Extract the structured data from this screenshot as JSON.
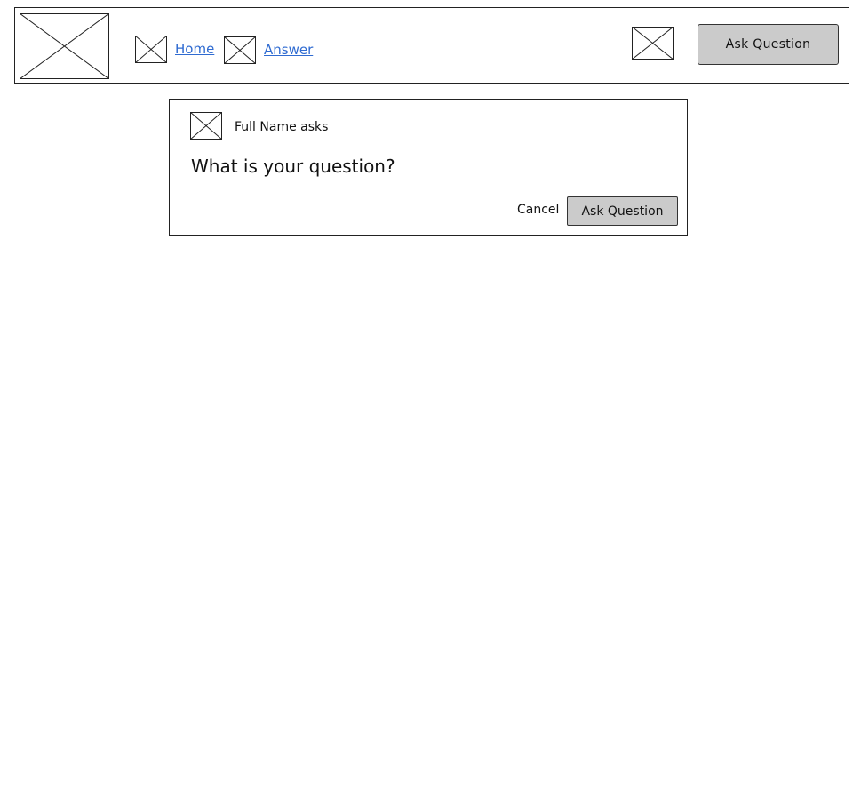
{
  "header": {
    "logo_icon": "image-placeholder-icon",
    "nav": [
      {
        "icon": "image-placeholder-icon",
        "label": "Home"
      },
      {
        "icon": "image-placeholder-icon",
        "label": "Answer"
      }
    ],
    "profile_icon": "image-placeholder-icon",
    "ask_button_label": "Ask Question",
    "link_color": "#2f6bd1",
    "button_color": "#cbcbcb"
  },
  "ask_panel": {
    "avatar_icon": "image-placeholder-icon",
    "asker_label": "Full Name asks",
    "question_placeholder": "What is your question?",
    "cancel_label": "Cancel",
    "submit_label": "Ask Question"
  }
}
